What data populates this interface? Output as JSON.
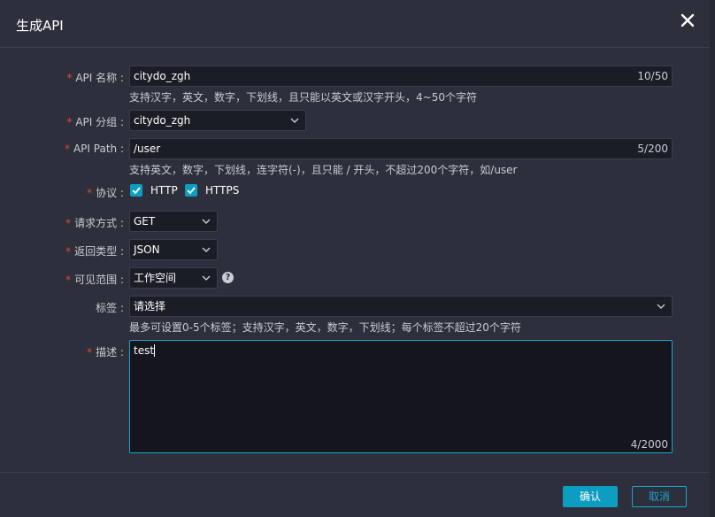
{
  "dialog": {
    "title": "生成API",
    "close_icon": "close-icon"
  },
  "form": {
    "api_name": {
      "label": "API 名称",
      "value": "citydo_zgh",
      "count": "10/50",
      "hint": "支持汉字，英文，数字，下划线，且只能以英文或汉字开头，4~50个字符"
    },
    "api_group": {
      "label": "API 分组",
      "value": "citydo_zgh"
    },
    "api_path": {
      "label": "API Path",
      "value": "/user",
      "count": "5/200",
      "hint": "支持英文，数字，下划线，连字符(-)，且只能 / 开头，不超过200个字符，如/user"
    },
    "protocol": {
      "label": "协议",
      "http": "HTTP",
      "https": "HTTPS"
    },
    "request_method": {
      "label": "请求方式",
      "value": "GET"
    },
    "return_type": {
      "label": "返回类型",
      "value": "JSON"
    },
    "visibility": {
      "label": "可见范围",
      "value": "工作空间",
      "help": "?"
    },
    "tags": {
      "label": "标签",
      "placeholder": "请选择",
      "hint": "最多可设置0-5个标签；支持汉字，英文，数字，下划线；每个标签不超过20个字符"
    },
    "description": {
      "label": "描述",
      "value": "test",
      "count": "4/2000"
    }
  },
  "footer": {
    "confirm_label": "确认",
    "cancel_label": "取消"
  },
  "colors": {
    "accent": "#0d9dc0",
    "required": "#e3443a",
    "background": "#2d303c"
  }
}
